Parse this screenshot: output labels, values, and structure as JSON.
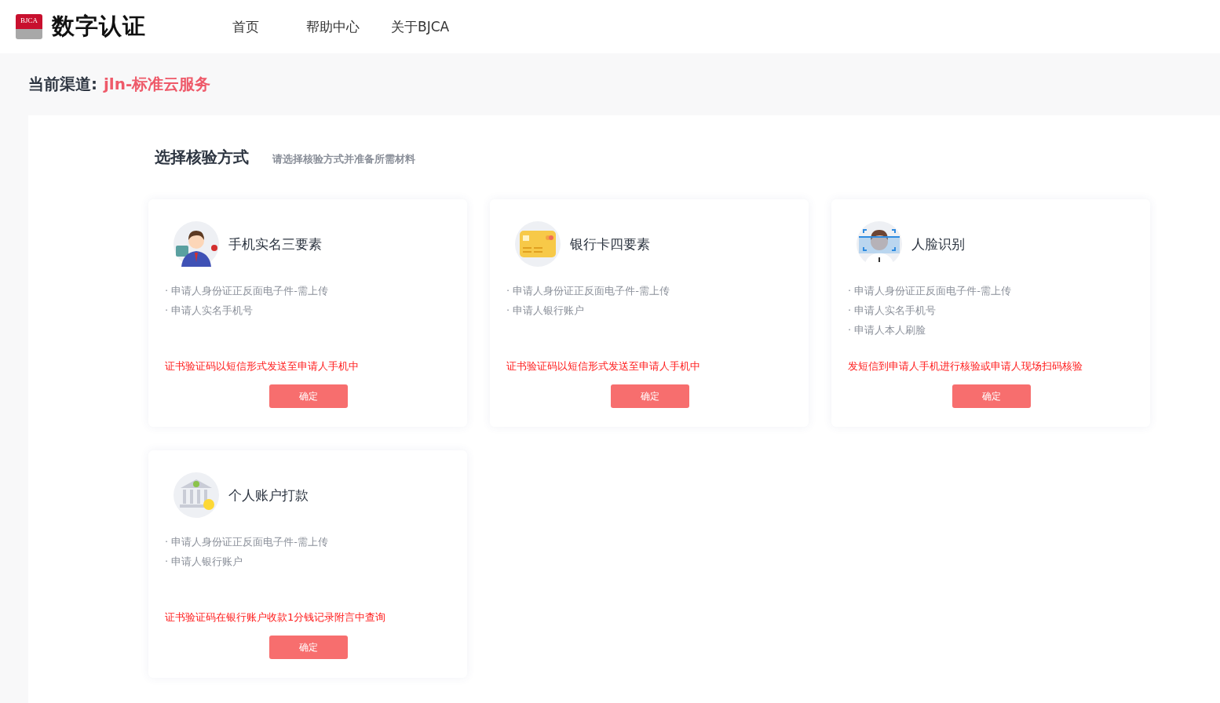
{
  "header": {
    "logo_badge": "BJCA",
    "logo_text": "数字认证",
    "nav": [
      {
        "label": "首页"
      },
      {
        "label": "帮助中心"
      },
      {
        "label": "关于BJCA"
      }
    ]
  },
  "channel": {
    "label": "当前渠道:",
    "value": "jln-标准云服务"
  },
  "section": {
    "title": "选择核验方式",
    "subtitle": "请选择核验方式并准备所需材料"
  },
  "cards": [
    {
      "kind": "phone",
      "title": "手机实名三要素",
      "requirements": [
        "· 申请人身份证正反面电子件-需上传",
        "· 申请人实名手机号"
      ],
      "note": "证书验证码以短信形式发送至申请人手机中",
      "button": "确定"
    },
    {
      "kind": "bankcard",
      "title": "银行卡四要素",
      "requirements": [
        "· 申请人身份证正反面电子件-需上传",
        "· 申请人银行账户"
      ],
      "note": "证书验证码以短信形式发送至申请人手机中",
      "button": "确定"
    },
    {
      "kind": "face",
      "title": "人脸识别",
      "requirements": [
        "· 申请人身份证正反面电子件-需上传",
        "· 申请人实名手机号",
        "· 申请人本人刷脸"
      ],
      "note": "发短信到申请人手机进行核验或申请人现场扫码核验",
      "button": "确定"
    },
    {
      "kind": "bank",
      "title": "个人账户打款",
      "requirements": [
        "· 申请人身份证正反面电子件-需上传",
        "· 申请人银行账户"
      ],
      "note": "证书验证码在银行账户收款1分钱记录附言中查询",
      "button": "确定"
    }
  ]
}
